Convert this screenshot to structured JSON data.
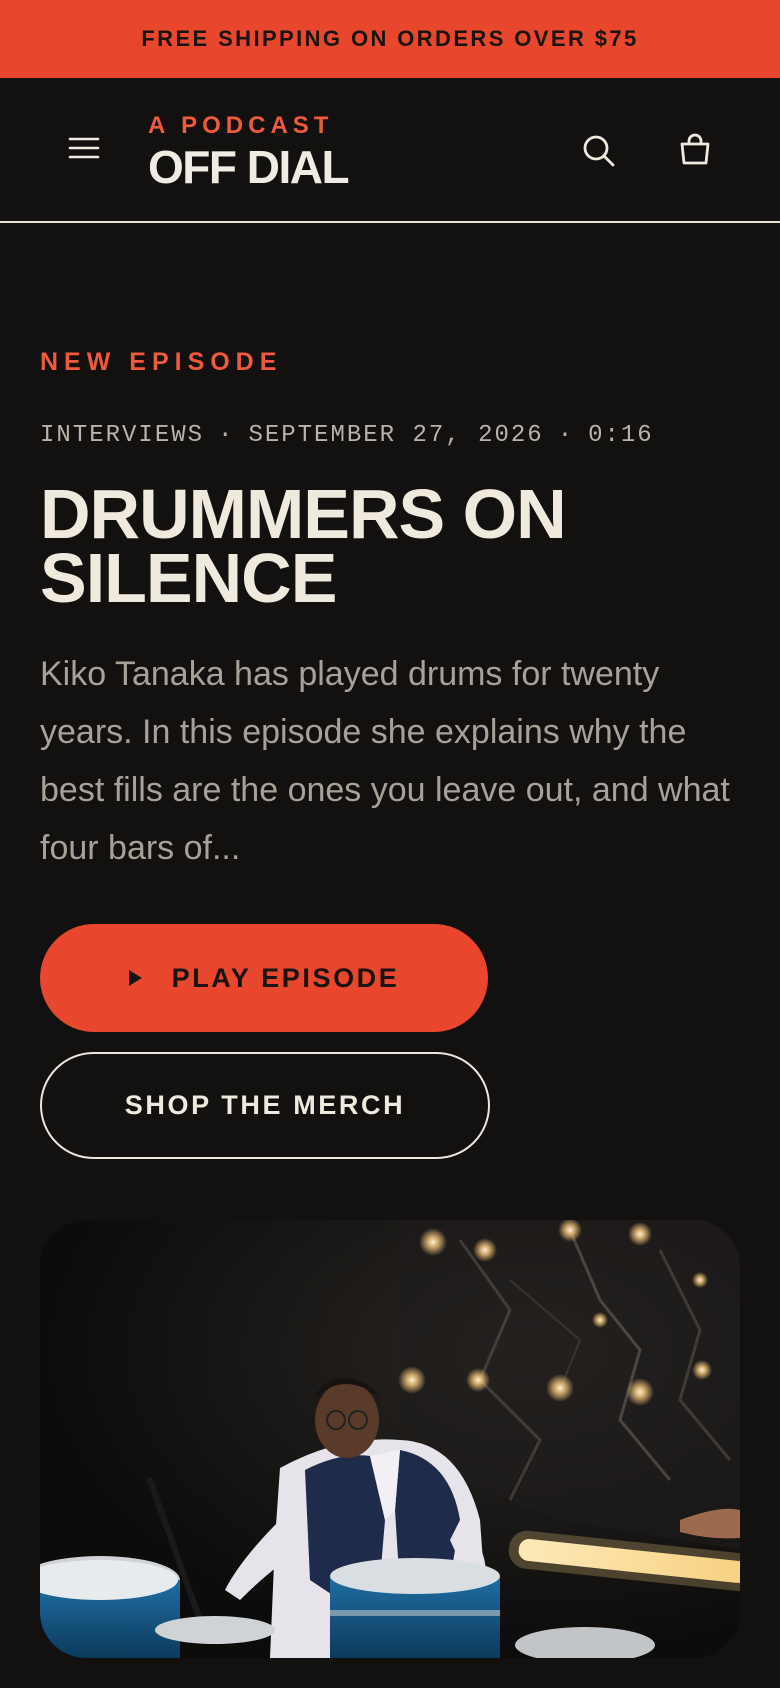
{
  "announcement": {
    "text": "FREE SHIPPING ON ORDERS OVER $75"
  },
  "header": {
    "brand_kicker": "A PODCAST",
    "brand_name": "OFF DIAL",
    "icons": {
      "menu": "menu-icon",
      "search": "search-icon",
      "cart": "shopping-bag-icon"
    }
  },
  "hero": {
    "eyebrow": "NEW EPISODE",
    "meta": {
      "category": "INTERVIEWS",
      "separator": "·",
      "date": "SEPTEMBER 27, 2026",
      "duration": "0:16"
    },
    "title": "DRUMMERS ON SILENCE",
    "description": "Kiko Tanaka has played drums for twenty years. In this episode she explains why the best fills are the ones you leave out, and what four bars of...",
    "play_label": "PLAY EPISODE",
    "merch_label": "SHOP THE MERCH",
    "image": "drummer-photo"
  },
  "colors": {
    "accent": "#e8472d",
    "background": "#121110",
    "text": "#efe9de",
    "muted": "#a7a198"
  }
}
